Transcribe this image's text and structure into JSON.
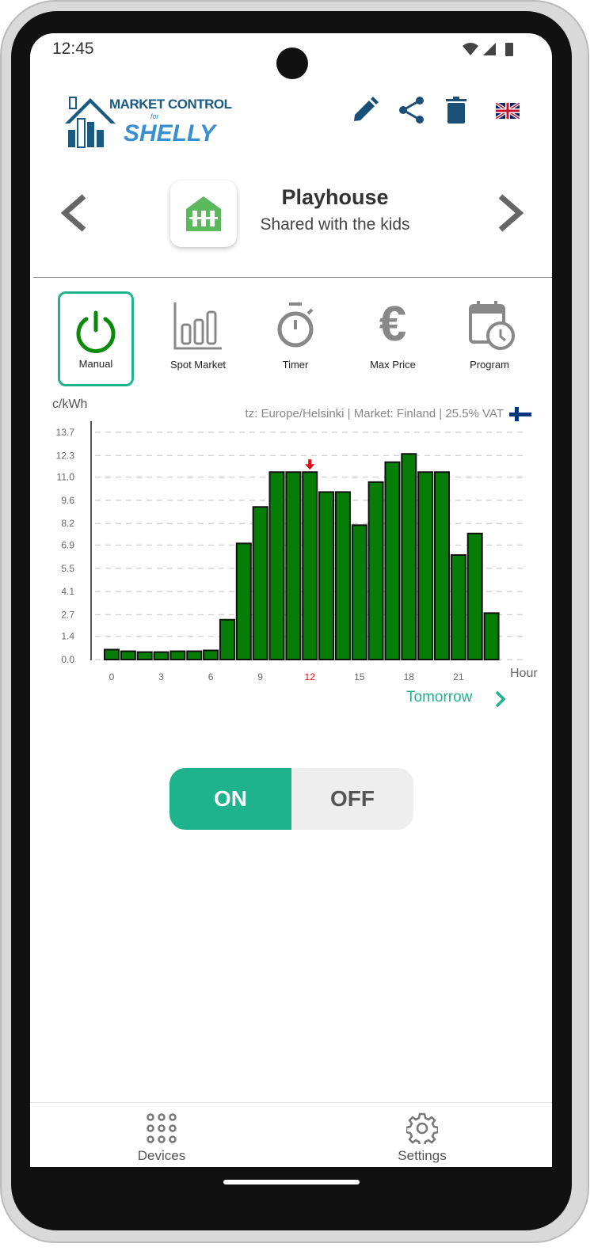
{
  "status_bar": {
    "time": "12:45"
  },
  "header": {
    "logo_text": {
      "line1": "MARKET CONTROL",
      "line2": "for",
      "line3": "SHELLY"
    },
    "actions": [
      "pencil-icon",
      "share-icon",
      "trash-icon",
      "uk-flag-icon"
    ],
    "icon_color": "#1a4f78"
  },
  "device": {
    "name": "Playhouse",
    "description": "Shared with the kids",
    "icon": "house-icon",
    "icon_color": "#5cb85c"
  },
  "modes": [
    {
      "label": "Manual",
      "icon": "power-icon",
      "active": true
    },
    {
      "label": "Spot Market",
      "icon": "bar-chart-icon"
    },
    {
      "label": "Timer",
      "icon": "stopwatch-icon"
    },
    {
      "label": "Max Price",
      "icon": "euro-icon"
    },
    {
      "label": "Program",
      "icon": "calendar-clock-icon"
    }
  ],
  "chart_info": "tz: Europe/Helsinki | Market: Finland | 25.5% VAT",
  "chart_data": {
    "type": "bar",
    "ylabel": "c/kWh",
    "xlabel": "Hour",
    "ylim": [
      0,
      13.7
    ],
    "y_ticks": [
      "0.0",
      "1.4",
      "2.7",
      "4.1",
      "5.5",
      "6.9",
      "8.2",
      "9.6",
      "11.0",
      "12.3",
      "13.7"
    ],
    "x_ticks": [
      "0",
      "3",
      "6",
      "9",
      "12",
      "15",
      "18",
      "21"
    ],
    "grid": true,
    "current_hour": 12,
    "bar_color": "#067d06",
    "x": [
      0,
      1,
      2,
      3,
      4,
      5,
      6,
      7,
      8,
      9,
      10,
      11,
      12,
      13,
      14,
      15,
      16,
      17,
      18,
      19,
      20,
      21,
      22,
      23
    ],
    "values": [
      0.6,
      0.5,
      0.45,
      0.45,
      0.5,
      0.5,
      0.55,
      2.4,
      7.0,
      9.2,
      11.3,
      11.3,
      11.3,
      10.1,
      10.1,
      8.1,
      10.7,
      11.9,
      12.4,
      11.3,
      11.3,
      6.3,
      7.6,
      2.8
    ]
  },
  "tomorrow_label": "Tomorrow",
  "toggle": {
    "on": "ON",
    "off": "OFF",
    "state": "ON",
    "accent": "#1eb38c"
  },
  "bottom_nav": [
    {
      "label": "Devices",
      "icon": "grid-icon"
    },
    {
      "label": "Settings",
      "icon": "gear-icon"
    }
  ]
}
